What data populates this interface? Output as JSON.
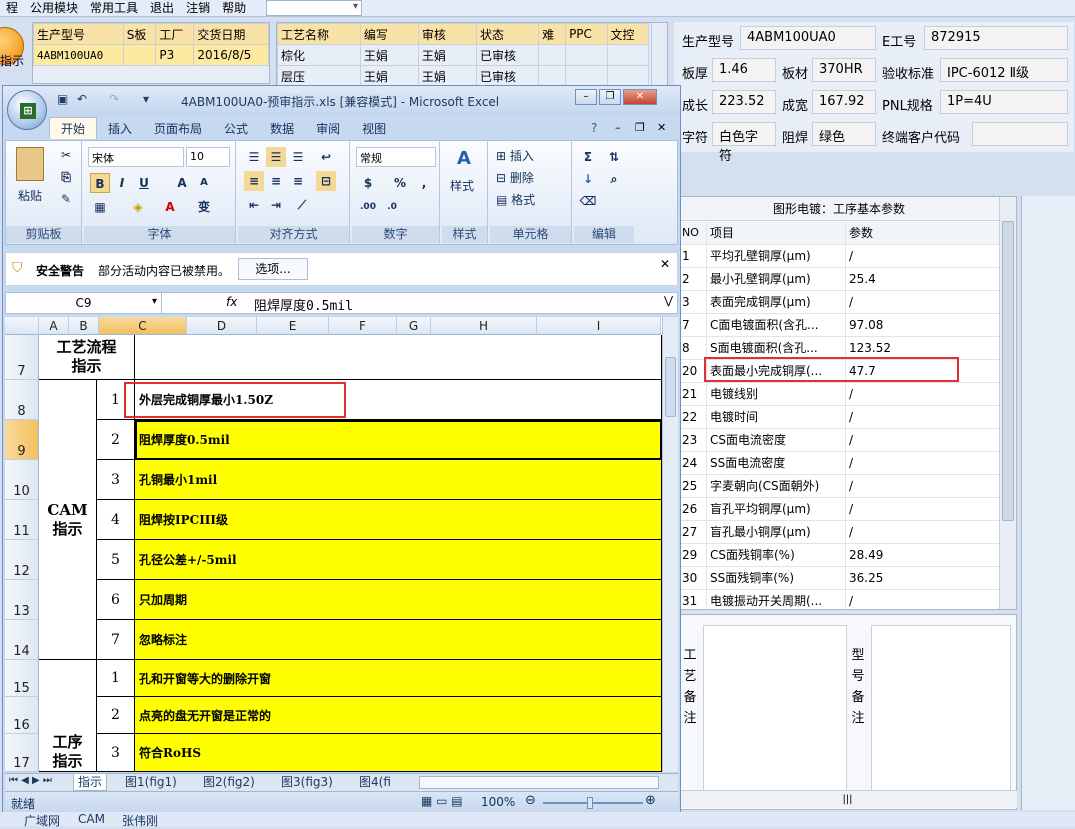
{
  "menubar": {
    "items": [
      "程",
      "公用模块",
      "常用工具",
      "退出",
      "注销",
      "帮助"
    ]
  },
  "left_btn": {
    "label": "指示"
  },
  "orders_table": {
    "headers": [
      "生产型号",
      "S板",
      "工厂",
      "交货日期"
    ],
    "rows": [
      [
        "4ABM100UA0",
        "",
        "P3",
        "2016/8/5"
      ]
    ]
  },
  "process_table": {
    "headers": [
      "工艺名称",
      "编写",
      "审核",
      "状态",
      "难",
      "PPC",
      "文控"
    ],
    "rows": [
      [
        "棕化",
        "王娟",
        "王娟",
        "已审核",
        "",
        "",
        ""
      ],
      [
        "层压",
        "王娟",
        "王娟",
        "已审核",
        "",
        "",
        ""
      ]
    ]
  },
  "info": {
    "model_label": "生产型号",
    "model": "4ABM100UA0",
    "e_label": "E工号",
    "e_value": "872915",
    "thick_label": "板厚",
    "thick": "1.46",
    "mat_label": "板材",
    "mat": "370HR",
    "std_label": "验收标准",
    "std": "IPC-6012 Ⅱ级",
    "len_label": "成长",
    "len": "223.52",
    "wid_label": "成宽",
    "wid": "167.92",
    "pnl_label": "PNL规格",
    "pnl": "1P=4U",
    "char_label": "字符",
    "char": "白色字符",
    "mask_label": "阻焊",
    "mask": "绿色",
    "cust_label": "终端客户代码",
    "cust": ""
  },
  "excel": {
    "title": "4ABM100UA0-预审指示.xls  [兼容模式] - Microsoft Excel",
    "tabs": [
      "开始",
      "插入",
      "页面布局",
      "公式",
      "数据",
      "审阅",
      "视图"
    ],
    "groups": [
      "剪贴板",
      "字体",
      "对齐方式",
      "数字",
      "样式",
      "单元格",
      "编辑"
    ],
    "paste": "粘贴",
    "font": "宋体",
    "font_size": "10",
    "number_format": "常规",
    "style": "样式",
    "insert": "插入",
    "delete": "删除",
    "format": "格式",
    "security_title": "安全警告",
    "security_msg": "部分活动内容已被禁用。",
    "options_btn": "选项...",
    "namebox": "C9",
    "fx": "fx",
    "formula": "阻焊厚度0.5mil",
    "columns": [
      "A",
      "B",
      "C",
      "D",
      "E",
      "F",
      "G",
      "H",
      "I"
    ],
    "rows": [
      "7",
      "8",
      "9",
      "10",
      "11",
      "12",
      "13",
      "14",
      "15",
      "16",
      "17"
    ],
    "row7_title": "工艺流程\n指示",
    "cam_group": "CAM\n指示",
    "proc_group": "工序\n指示",
    "cam_items": [
      {
        "n": "1",
        "t": "外层完成铜厚最小1.50Z"
      },
      {
        "n": "2",
        "t": "阻焊厚度0.5mil"
      },
      {
        "n": "3",
        "t": "孔铜最小1mil"
      },
      {
        "n": "4",
        "t": "阻焊按IPCIII级"
      },
      {
        "n": "5",
        "t": "孔径公差+/-5mil"
      },
      {
        "n": "6",
        "t": "只加周期"
      },
      {
        "n": "7",
        "t": "忽略标注"
      }
    ],
    "proc_items": [
      {
        "n": "1",
        "t": "孔和开窗等大的删除开窗"
      },
      {
        "n": "2",
        "t": "点亮的盘无开窗是正常的"
      },
      {
        "n": "3",
        "t": "符合RoHS"
      }
    ],
    "sheet_tabs": [
      "指示",
      "图1(fig1)",
      "图2(fig2)",
      "图3(fig3)",
      "图4(fi"
    ],
    "status": "就绪",
    "zoom": "100%"
  },
  "params": {
    "title": "图形电镀：工序基本参数",
    "headers": [
      "NO",
      "项目",
      "参数"
    ],
    "rows": [
      {
        "no": "1",
        "item": "平均孔壁铜厚(μm)",
        "val": "/"
      },
      {
        "no": "2",
        "item": "最小孔壁铜厚(μm)",
        "val": "25.4"
      },
      {
        "no": "3",
        "item": "表面完成铜厚(μm)",
        "val": "/"
      },
      {
        "no": "7",
        "item": "C面电镀面积(含孔...",
        "val": "97.08"
      },
      {
        "no": "8",
        "item": "S面电镀面积(含孔...",
        "val": "123.52"
      },
      {
        "no": "20",
        "item": "表面最小完成铜厚(...",
        "val": "47.7"
      },
      {
        "no": "21",
        "item": "电镀线别",
        "val": "/"
      },
      {
        "no": "22",
        "item": "电镀时间",
        "val": "/"
      },
      {
        "no": "23",
        "item": "CS面电流密度",
        "val": "/"
      },
      {
        "no": "24",
        "item": "SS面电流密度",
        "val": "/"
      },
      {
        "no": "25",
        "item": "字麦朝向(CS面朝外)",
        "val": "/"
      },
      {
        "no": "26",
        "item": "盲孔平均铜厚(μm)",
        "val": "/"
      },
      {
        "no": "27",
        "item": "盲孔最小铜厚(μm)",
        "val": "/"
      },
      {
        "no": "29",
        "item": "CS面残铜率(%)",
        "val": "28.49"
      },
      {
        "no": "30",
        "item": "SS面残铜率(%)",
        "val": "36.25"
      },
      {
        "no": "31",
        "item": "电镀振动开关周期(...",
        "val": "/"
      }
    ]
  },
  "notes": {
    "left": "工\n艺\n备\n注",
    "right": "型\n号\n备\n注"
  },
  "bottom": {
    "items": [
      "广域网",
      "CAM",
      "张伟刚"
    ]
  }
}
